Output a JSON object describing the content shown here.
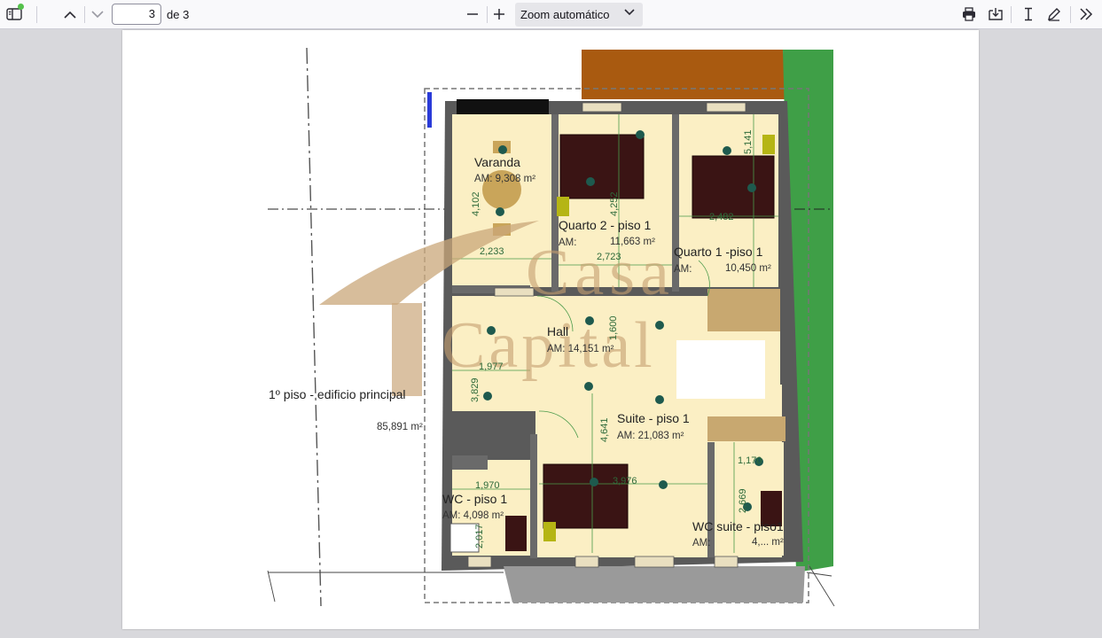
{
  "toolbar": {
    "current_page": "3",
    "page_total_label": "de 3",
    "zoom_label": "Zoom automático",
    "icons": [
      "sidebar-toggle-icon",
      "chevron-up-icon",
      "chevron-down-icon",
      "zoom-out-icon",
      "zoom-in-icon",
      "print-icon",
      "save-icon",
      "text-cursor-icon",
      "pen-icon",
      "more-tools-icon"
    ]
  },
  "plan": {
    "rooms": {
      "varanda": {
        "name": "Varanda",
        "area": "AM: 9,308 m²"
      },
      "quarto2": {
        "name": "Quarto 2 - piso 1",
        "area_label": "AM:",
        "area_value": "11,663 m²"
      },
      "quarto1": {
        "name": "Quarto 1 -piso 1",
        "area_label": "AM:",
        "area_value": "10,450 m²"
      },
      "hall": {
        "name": "Hall",
        "area": "AM: 14,151 m²"
      },
      "suite": {
        "name": "Suite - piso 1",
        "area": "AM:  21,083 m²"
      },
      "wc": {
        "name": "WC - piso 1",
        "area": "AM:  4,098 m²"
      },
      "wc_suite": {
        "name": "WC suite - piso1",
        "area_label": "AM:",
        "area_value": "4,... m²"
      }
    },
    "building_label": "1º piso  - edificio principal",
    "building_area": "85,891 m²",
    "dimensions": {
      "d4102": "4,102",
      "d2233": "2,233",
      "d4252": "4,252",
      "d2723": "2,723",
      "d5141": "5,141",
      "d2482": "2,482",
      "d1600": "1,600",
      "d1977": "1,977",
      "d3829": "3,829",
      "d4641": "4,641",
      "d3976": "3,976",
      "d1970": "1,970",
      "d2017": "2,017",
      "d2669": "2,669",
      "d1170": "1,170"
    },
    "watermark_text": [
      "Casa",
      "Capital"
    ],
    "colors": {
      "wall": "#5a5a5a",
      "floor": "#fbefc4",
      "bed": "#3a1414",
      "roof": "#a95a10",
      "lawn": "#3f9f47",
      "dim_line": "#4a9a4a"
    }
  }
}
